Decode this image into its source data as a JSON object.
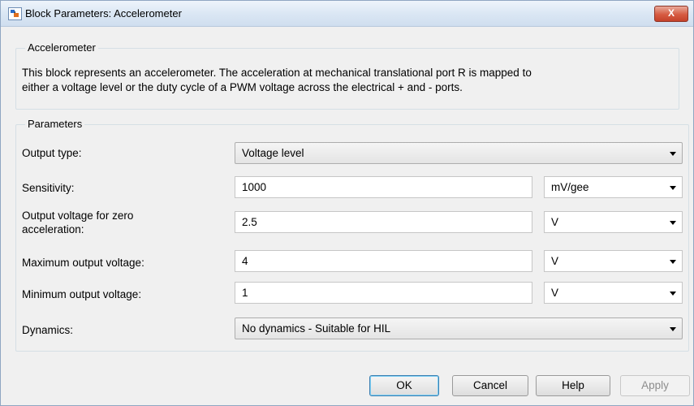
{
  "window": {
    "title": "Block Parameters: Accelerometer",
    "close_label": "X"
  },
  "block": {
    "name": "Accelerometer",
    "description_line1": "This block represents an accelerometer. The acceleration at mechanical translational port R is mapped to",
    "description_line2": "either a voltage level or the duty cycle of a PWM voltage across the electrical + and - ports."
  },
  "parameters": {
    "section_label": "Parameters",
    "output_type": {
      "label": "Output type:",
      "value": "Voltage level"
    },
    "sensitivity": {
      "label": "Sensitivity:",
      "value": "1000",
      "unit": "mV/gee"
    },
    "zero_accel_voltage": {
      "label_line1": "Output voltage for zero",
      "label_line2": "acceleration:",
      "value": "2.5",
      "unit": "V"
    },
    "max_output_voltage": {
      "label": "Maximum output voltage:",
      "value": "4",
      "unit": "V"
    },
    "min_output_voltage": {
      "label": "Minimum output voltage:",
      "value": "1",
      "unit": "V"
    },
    "dynamics": {
      "label": "Dynamics:",
      "value": "No dynamics - Suitable for HIL"
    }
  },
  "buttons": {
    "ok": "OK",
    "cancel": "Cancel",
    "help": "Help",
    "apply": "Apply"
  }
}
